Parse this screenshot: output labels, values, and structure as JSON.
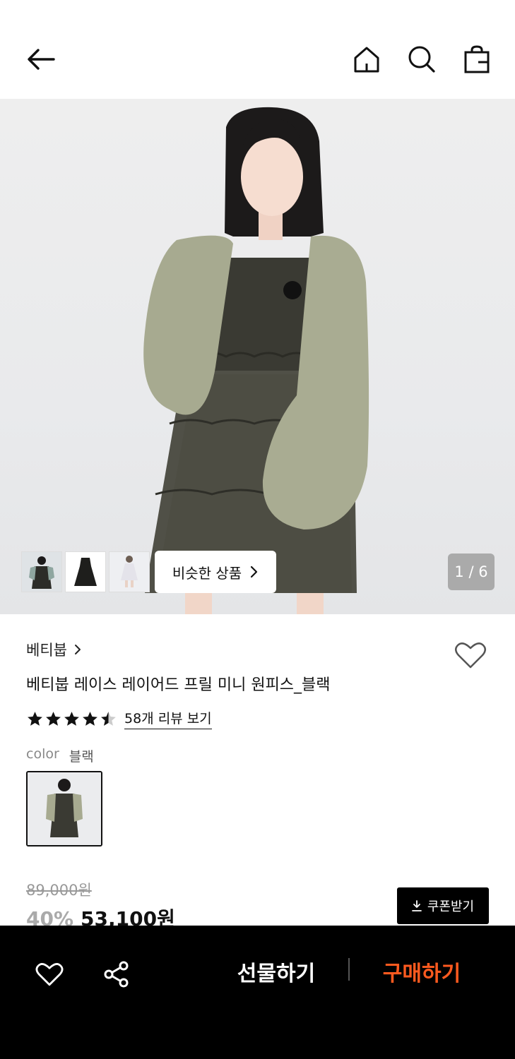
{
  "header": {
    "back_icon": "arrow-left-icon",
    "home_icon": "home-icon",
    "search_icon": "search-icon",
    "bag_icon": "shopping-bag-icon"
  },
  "gallery": {
    "similar_label": "비슷한 상품",
    "page_indicator": "1 / 6",
    "thumbnails": [
      "dress-with-cardigan",
      "black-slip-dress",
      "white-dress"
    ]
  },
  "product": {
    "brand": "베티붑",
    "name": "베티붑 레이스 레이어드 프릴 미니 원피스_블랙",
    "rating": 4.5,
    "review_link": "58개 리뷰 보기",
    "color_label": "color",
    "color_value": "블랙",
    "original_price": "89,000원",
    "discount": "40%",
    "sale_price": "53,100원",
    "coupon_label": "쿠폰받기"
  },
  "bottom_bar": {
    "gift_label": "선물하기",
    "buy_label": "구매하기",
    "buy_color": "#ff5a1f"
  }
}
